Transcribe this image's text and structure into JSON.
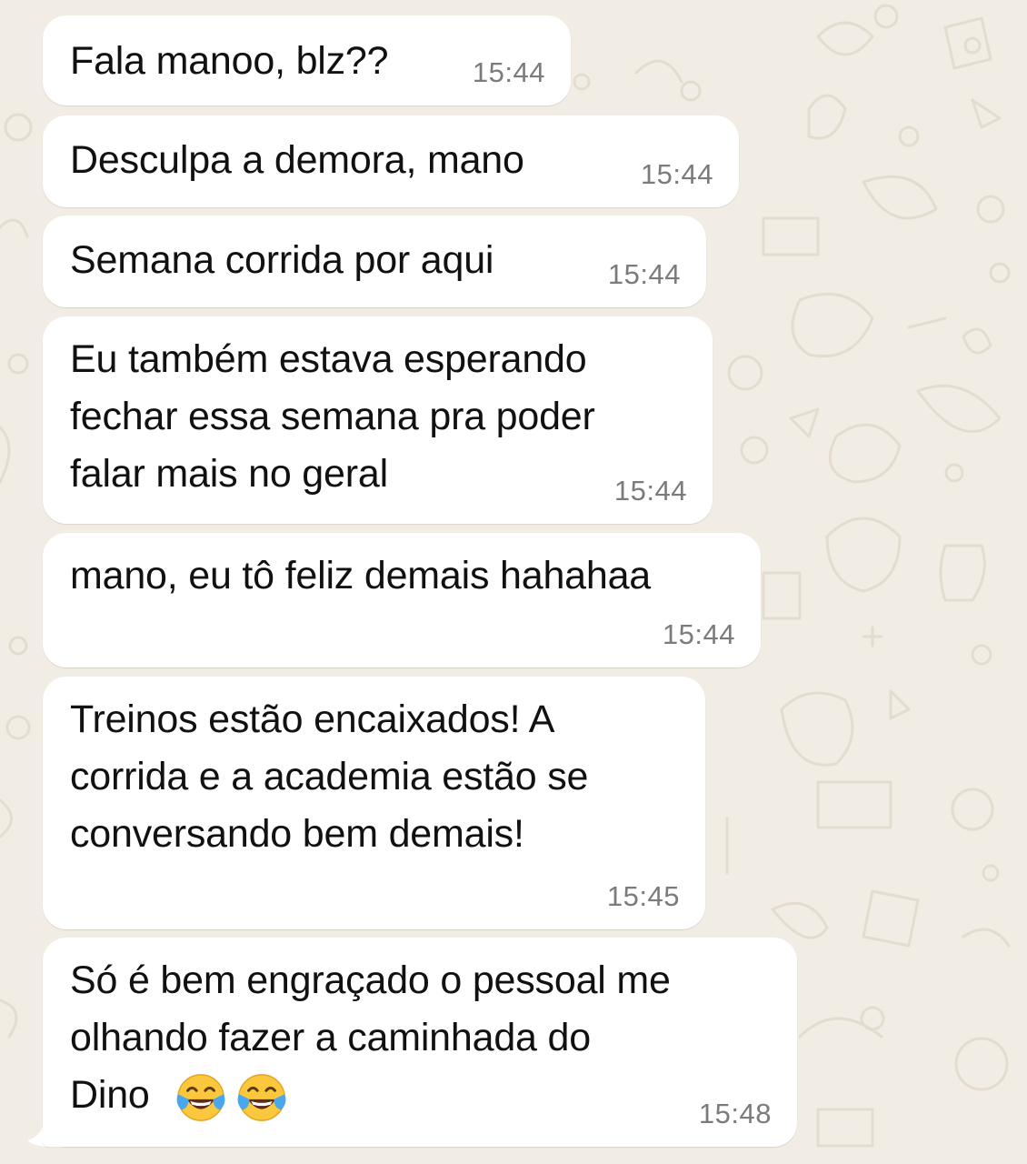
{
  "colors": {
    "background": "#f1ece4",
    "bubble": "#ffffff",
    "text": "#111111",
    "time": "#7b7b7b",
    "doodle": "#e4dccf"
  },
  "messages": [
    {
      "text": "Fala manoo, blz??",
      "time": "15:44"
    },
    {
      "text": "Desculpa a demora, mano",
      "time": "15:44"
    },
    {
      "text": "Semana corrida por aqui",
      "time": "15:44"
    },
    {
      "text": "Eu também estava esperando\nfechar essa semana pra poder\nfalar mais no geral",
      "time": "15:44"
    },
    {
      "text": "mano, eu tô feliz demais hahahaa",
      "time": "15:44"
    },
    {
      "text": "Treinos estão encaixados! A\ncorrida e a academia estão se\nconversando bem demais!",
      "time": "15:45"
    },
    {
      "text": "Só é bem engraçado o pessoal me\nolhando fazer a caminhada do\nDino",
      "time": "15:48",
      "emojis": [
        "face-with-tears-of-joy-icon",
        "face-with-tears-of-joy-icon"
      ]
    }
  ]
}
